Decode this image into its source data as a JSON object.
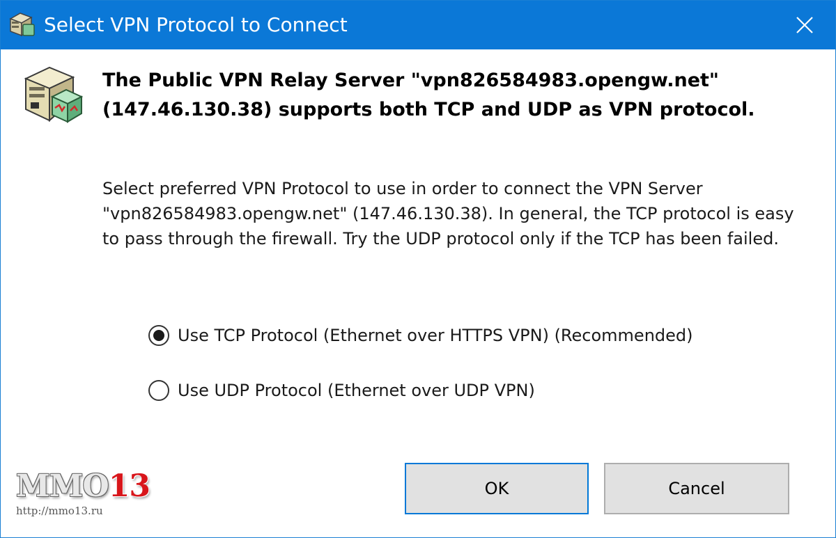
{
  "window": {
    "title": "Select VPN Protocol to Connect",
    "icon": "vpn-server-icon",
    "close_icon": "close-icon",
    "accent_color": "#0b78d7"
  },
  "header": {
    "icon": "vpn-relay-server-icon",
    "line1": "The Public VPN Relay Server \"vpn826584983.opengw.net\"",
    "line2": "(147.46.130.38) supports both TCP and UDP as VPN protocol."
  },
  "description": {
    "line1": "Select preferred VPN Protocol to use in order to connect the VPN Server",
    "line2": "\"vpn826584983.opengw.net\" (147.46.130.38). In general, the TCP protocol is easy",
    "line3": "to pass through the firewall. Try the UDP protocol only if the TCP has been failed."
  },
  "options": [
    {
      "label": "Use TCP Protocol (Ethernet over HTTPS VPN) (Recommended)",
      "selected": true
    },
    {
      "label": "Use UDP Protocol (Ethernet over UDP VPN)",
      "selected": false
    }
  ],
  "buttons": {
    "ok": "OK",
    "cancel": "Cancel"
  },
  "watermark": {
    "brand": "MMO",
    "number": "13",
    "url": "http://mmo13.ru"
  }
}
